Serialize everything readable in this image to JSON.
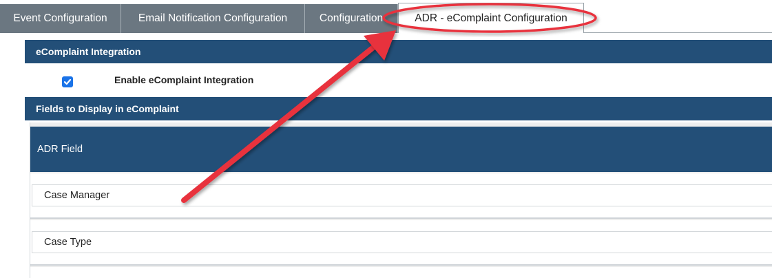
{
  "tabs": [
    {
      "label": "Event Configuration"
    },
    {
      "label": "Email Notification Configuration"
    },
    {
      "label": "Configuration"
    },
    {
      "label": "ADR - eComplaint Configuration"
    }
  ],
  "integration": {
    "header": "eComplaint Integration",
    "enable_label": "Enable eComplaint Integration",
    "enabled": true
  },
  "fields_section": {
    "header": "Fields to Display in eComplaint",
    "column_header": "ADR Field",
    "rows": [
      {
        "label": "Case Manager"
      },
      {
        "label": "Case Type"
      }
    ]
  },
  "colors": {
    "header_bg": "#234f78",
    "tab_inactive_bg": "#6b7781",
    "annotation_red": "#e8323c",
    "checkbox_blue": "#1a73e8"
  }
}
